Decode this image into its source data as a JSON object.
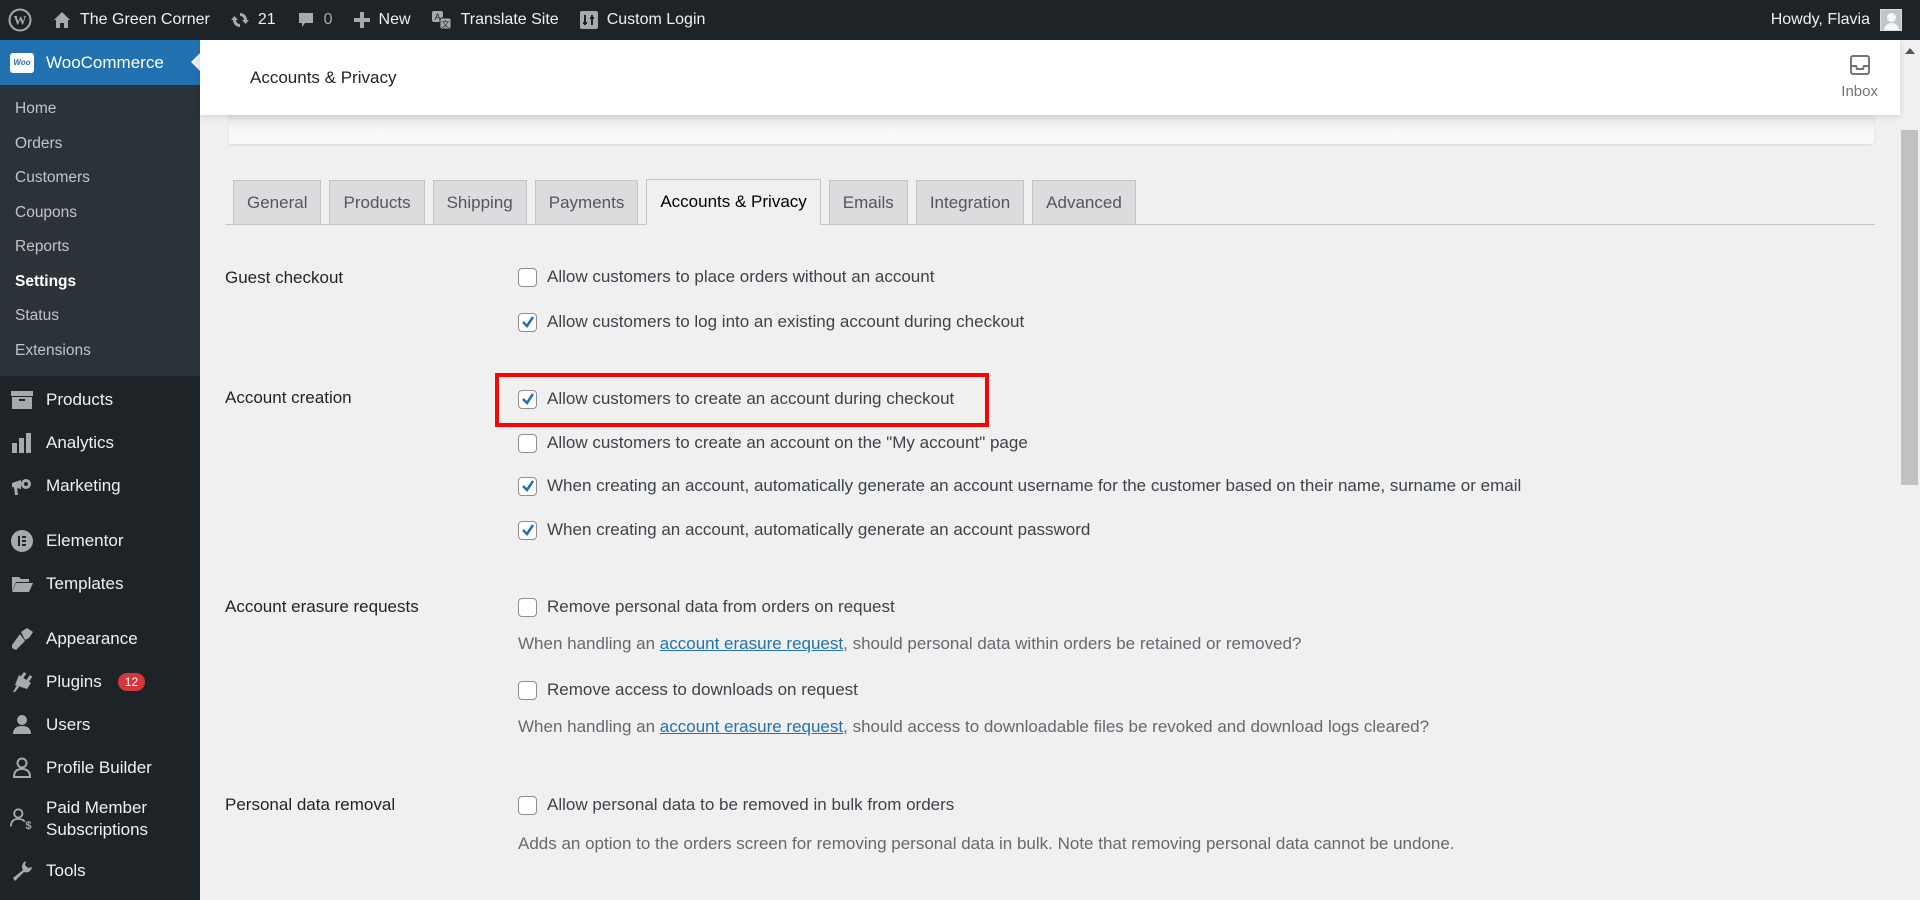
{
  "adminbar": {
    "site_name": "The Green Corner",
    "updates_count": "21",
    "comments_count": "0",
    "new_label": "New",
    "translate_label": "Translate Site",
    "custom_login_label": "Custom Login",
    "howdy": "Howdy, Flavia"
  },
  "sidebar": {
    "woo_logo": "Woo",
    "woo_label": "WooCommerce",
    "submenu": [
      "Home",
      "Orders",
      "Customers",
      "Coupons",
      "Reports",
      "Settings",
      "Status",
      "Extensions"
    ],
    "current_submenu": "Settings",
    "menu": [
      {
        "label": "Products",
        "icon": "archive-icon"
      },
      {
        "label": "Analytics",
        "icon": "bar-chart-icon"
      },
      {
        "label": "Marketing",
        "icon": "megaphone-icon"
      },
      {
        "label": "Elementor",
        "icon": "elementor-icon"
      },
      {
        "label": "Templates",
        "icon": "folder-icon"
      },
      {
        "label": "Appearance",
        "icon": "paintbrush-icon"
      },
      {
        "label": "Plugins",
        "icon": "plug-icon",
        "badge": "12"
      },
      {
        "label": "Users",
        "icon": "user-icon"
      },
      {
        "label": "Profile Builder",
        "icon": "user-outline-icon"
      },
      {
        "label": "Paid Member Subscriptions",
        "icon": "user-dollar-icon"
      },
      {
        "label": "Tools",
        "icon": "wrench-icon"
      }
    ]
  },
  "header": {
    "title": "Accounts & Privacy",
    "inbox_label": "Inbox"
  },
  "tabs": [
    "General",
    "Products",
    "Shipping",
    "Payments",
    "Accounts & Privacy",
    "Emails",
    "Integration",
    "Advanced"
  ],
  "active_tab": "Accounts & Privacy",
  "form": {
    "guest_checkout": {
      "label": "Guest checkout",
      "options": [
        {
          "label": "Allow customers to place orders without an account",
          "checked": false
        },
        {
          "label": "Allow customers to log into an existing account during checkout",
          "checked": true
        }
      ]
    },
    "account_creation": {
      "label": "Account creation",
      "options": [
        {
          "label": "Allow customers to create an account during checkout",
          "checked": true,
          "highlighted": true
        },
        {
          "label": "Allow customers to create an account on the \"My account\" page",
          "checked": false
        },
        {
          "label": "When creating an account, automatically generate an account username for the customer based on their name, surname or email",
          "checked": true
        },
        {
          "label": "When creating an account, automatically generate an account password",
          "checked": true
        }
      ]
    },
    "account_erasure": {
      "label": "Account erasure requests",
      "options": [
        {
          "label": "Remove personal data from orders on request",
          "checked": false,
          "desc_before": "When handling an ",
          "desc_link": "account erasure request",
          "desc_after": ", should personal data within orders be retained or removed?"
        },
        {
          "label": "Remove access to downloads on request",
          "checked": false,
          "desc_before": "When handling an ",
          "desc_link": "account erasure request",
          "desc_after": ", should access to downloadable files be revoked and download logs cleared?"
        }
      ]
    },
    "personal_data_removal": {
      "label": "Personal data removal",
      "options": [
        {
          "label": "Allow personal data to be removed in bulk from orders",
          "checked": false,
          "desc": "Adds an option to the orders screen for removing personal data in bulk. Note that removing personal data cannot be undone."
        }
      ]
    }
  },
  "colors": {
    "accent": "#2271b1",
    "highlight_box": "#ff0000",
    "badge": "#d63638",
    "adminbar_bg": "#1d2327"
  }
}
